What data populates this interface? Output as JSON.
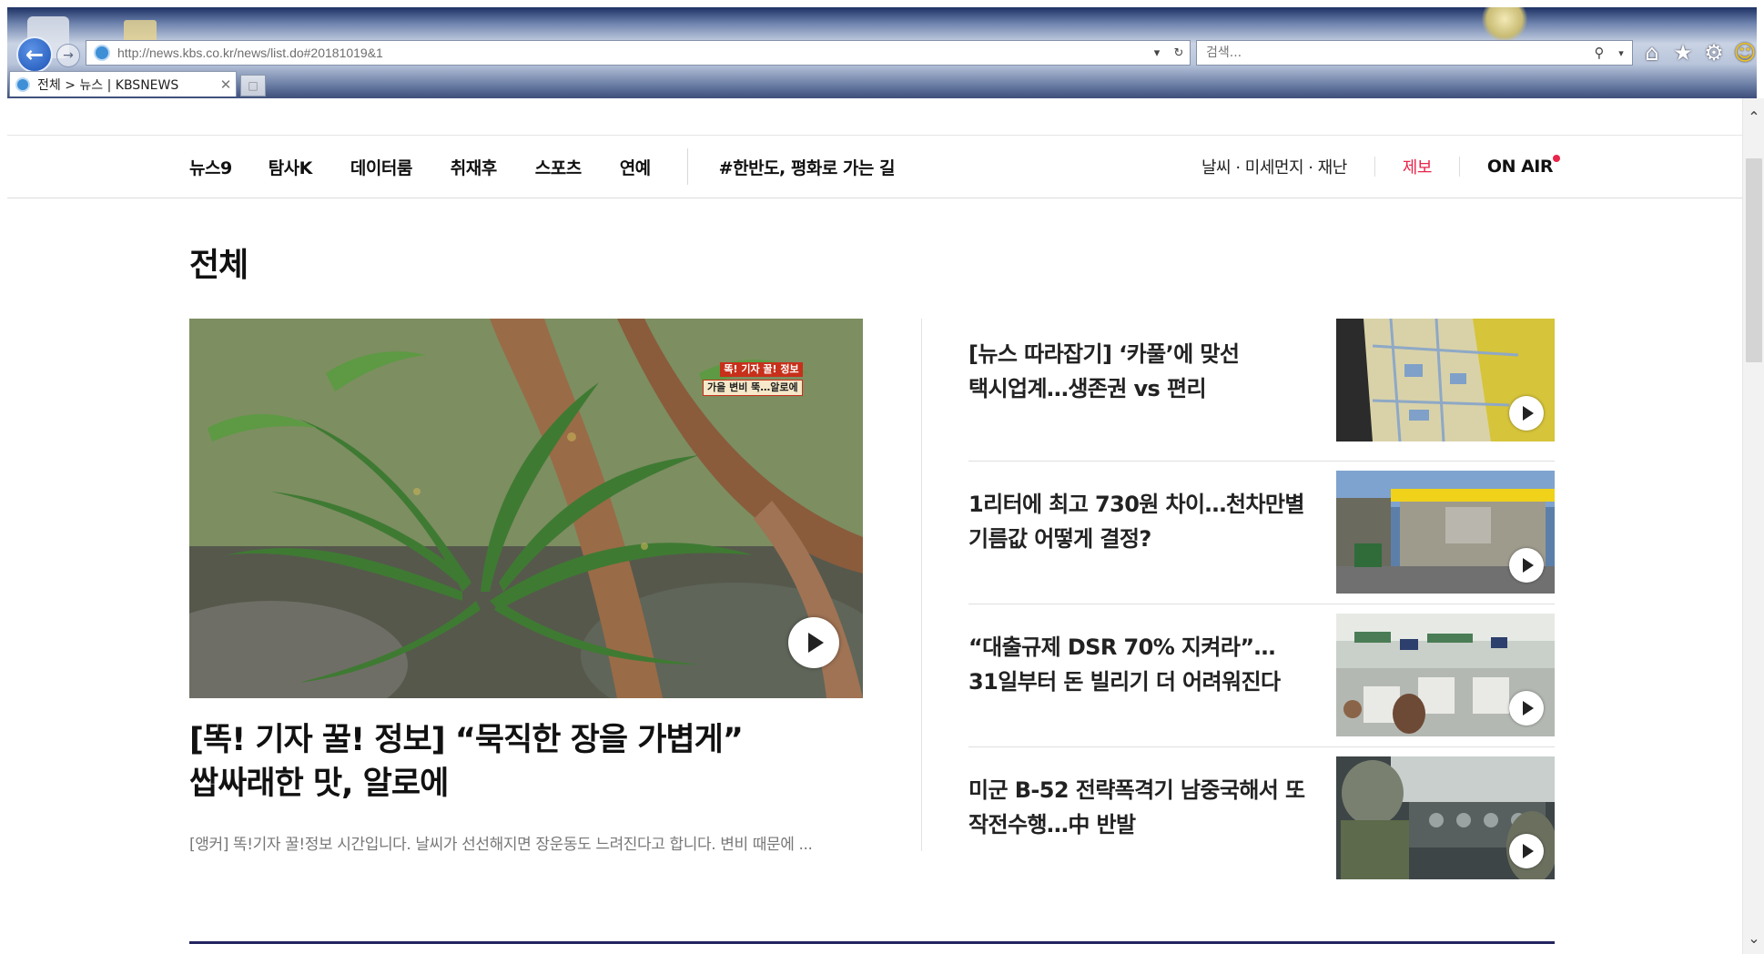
{
  "browser": {
    "url": "http://news.kbs.co.kr/news/list.do#20181019&1",
    "search_placeholder": "검색...",
    "tab_title": "전체 > 뉴스 | KBSNEWS",
    "icons": [
      "back-arrow-icon",
      "forward-arrow-icon",
      "refresh-icon",
      "search-icon",
      "home-icon",
      "favorites-star-icon",
      "settings-gear-icon",
      "smiley-feedback-icon"
    ]
  },
  "nav": {
    "menu": [
      "뉴스9",
      "탐사K",
      "데이터룸",
      "취재후",
      "스포츠",
      "연예"
    ],
    "hashtag": "#한반도, 평화로 가는 길",
    "weather": "날씨 · 미세먼지 · 재난",
    "report": "제보",
    "onair": "ON AIR"
  },
  "page": {
    "title": "전체"
  },
  "lead": {
    "image_caption_line1": "똑! 기자 꿀! 정보",
    "image_caption_line2": "가을 변비 뚝…알로에",
    "headline_line1": "[똑! 기자 꿀! 정보] “묵직한 장을 가볍게”",
    "headline_line2": "쌉싸래한 맛, 알로에",
    "summary": "[앵커] 똑!기자 꿀!정보 시간입니다. 날씨가 선선해지면 장운동도 느려진다고 합니다. 변비 때문에 ..."
  },
  "side_articles": [
    {
      "line1": "[뉴스 따라잡기] ‘카풀’에 맞선",
      "line2": "택시업계…생존권 vs 편리"
    },
    {
      "line1": "1리터에 최고 730원 차이…천차만별",
      "line2": "기름값 어떻게 결정?"
    },
    {
      "line1": "“대출규제 DSR 70% 지켜라”…",
      "line2": "31일부터 돈 빌리기 더 어려워진다"
    },
    {
      "line1": "미군 B-52 전략폭격기 남중국해서 또",
      "line2": "작전수행…中 반발"
    }
  ],
  "colors": {
    "accent_red": "#e8254a",
    "hashtag_blue": "#5b6b9a",
    "bottom_rule": "#232560"
  }
}
